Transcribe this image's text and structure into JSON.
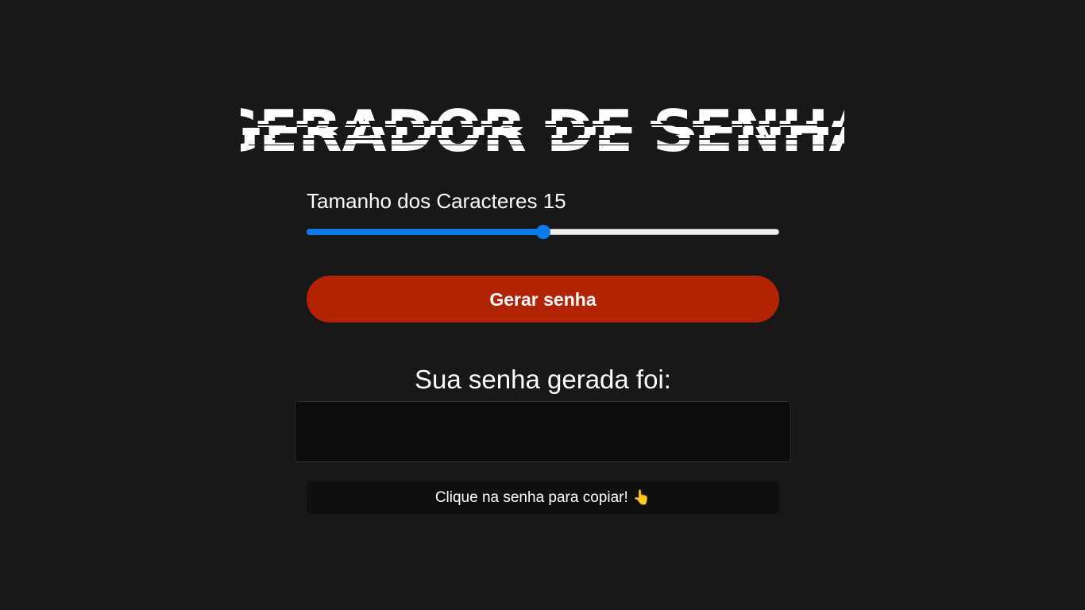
{
  "header": {
    "title": "GERADOR DE SENHA"
  },
  "settings": {
    "size_label": "Tamanho dos Caracteres",
    "size_value": "15",
    "slider_fraction": 0.5
  },
  "actions": {
    "generate_label": "Gerar senha"
  },
  "result": {
    "title": "Sua senha gerada foi:",
    "password": "",
    "copy_hint": "Clique na senha para copiar!",
    "copy_hint_icon": "pointing-hand-icon"
  },
  "colors": {
    "background": "#181818",
    "button": "#b22304",
    "slider_accent": "#0f7aea",
    "box": "#0c0c0c"
  }
}
